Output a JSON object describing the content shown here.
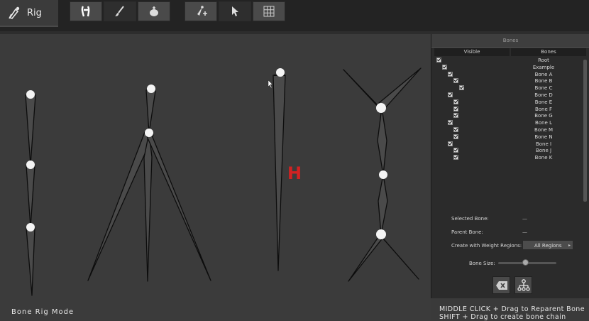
{
  "toolbar": {
    "mode_tab_label": "Rig",
    "mode_tab_icon": "rig-pen-icon",
    "tool_groups": [
      [
        "skeleton-icon",
        "brush-icon",
        "weight-bucket-icon"
      ],
      [
        "create-bone-icon",
        "select-cursor-icon",
        "grid-icon"
      ]
    ]
  },
  "viewport": {
    "mode_label": "Bone Rig Mode",
    "gizmo_glyph": "H",
    "accent_color": "#d22222"
  },
  "panel": {
    "title": "Bones",
    "col_visible": "Visible",
    "col_bones": "Bones",
    "bones": [
      {
        "name": "Root",
        "depth": 0
      },
      {
        "name": "Example",
        "depth": 1
      },
      {
        "name": "Bone A",
        "depth": 2
      },
      {
        "name": "Bone B",
        "depth": 3
      },
      {
        "name": "Bone C",
        "depth": 4
      },
      {
        "name": "Bone D",
        "depth": 2
      },
      {
        "name": "Bone E",
        "depth": 3
      },
      {
        "name": "Bone F",
        "depth": 3
      },
      {
        "name": "Bone G",
        "depth": 3
      },
      {
        "name": "Bone L",
        "depth": 2
      },
      {
        "name": "Bone M",
        "depth": 3
      },
      {
        "name": "Bone N",
        "depth": 3
      },
      {
        "name": "Bone I",
        "depth": 2
      },
      {
        "name": "Bone J",
        "depth": 3
      },
      {
        "name": "Bone K",
        "depth": 3
      }
    ],
    "selected_bone_label": "Selected Bone:",
    "selected_bone_value": "—",
    "parent_bone_label": "Parent Bone:",
    "parent_bone_value": "—",
    "weight_regions_label": "Create with Weight Regions:",
    "weight_regions_value": "All Regions",
    "bone_size_label": "Bone Size:",
    "bone_size_level": 0.5,
    "delete_icon": "backspace-icon",
    "hierarchy_icon": "hierarchy-icon"
  },
  "hints": {
    "line1": "MIDDLE CLICK + Drag to Reparent Bone",
    "line2": "SHIFT + Drag to create bone chain"
  }
}
